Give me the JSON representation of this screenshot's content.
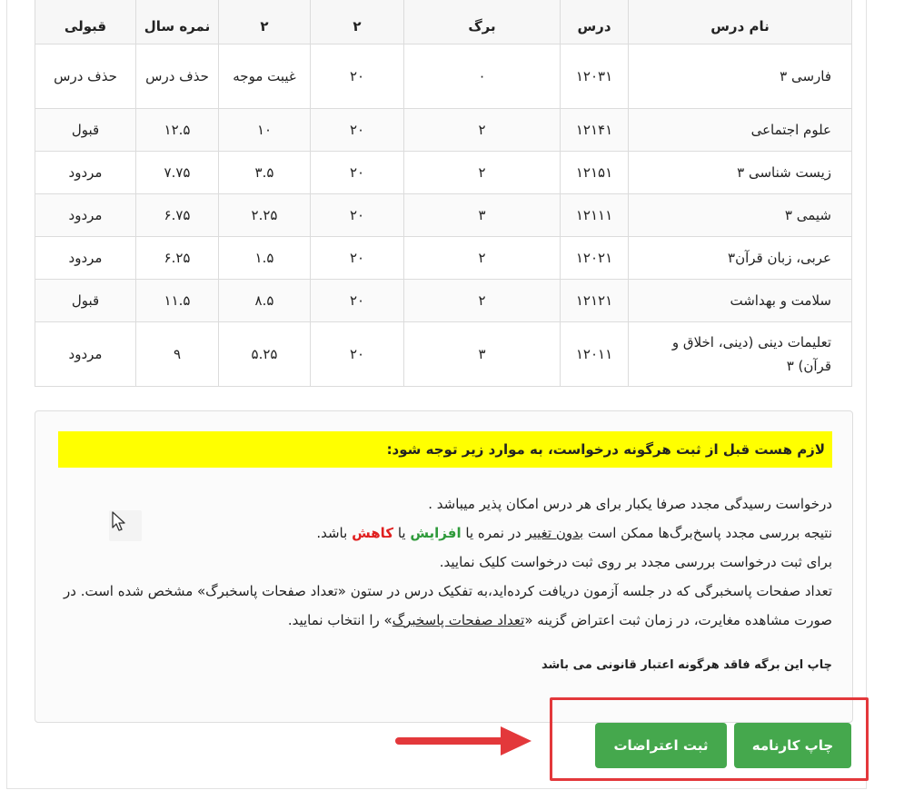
{
  "table": {
    "headers": [
      "نام درس",
      "درس",
      "برگ",
      "۲",
      "۲",
      "نمره سال",
      "قبولی"
    ],
    "rows": [
      [
        "فارسی ۳",
        "۱۲۰۳۱",
        "۰",
        "۲۰",
        "غیبت موجه",
        "حذف درس",
        "حذف درس"
      ],
      [
        "علوم اجتماعی",
        "۱۲۱۴۱",
        "۲",
        "۲۰",
        "۱۰",
        "۱۲.۵",
        "قبول"
      ],
      [
        "زیست شناسی ۳",
        "۱۲۱۵۱",
        "۲",
        "۲۰",
        "۳.۵",
        "۷.۷۵",
        "مردود"
      ],
      [
        "شیمی ۳",
        "۱۲۱۱۱",
        "۳",
        "۲۰",
        "۲.۲۵",
        "۶.۷۵",
        "مردود"
      ],
      [
        "عربی، زبان قرآن۳",
        "۱۲۰۲۱",
        "۲",
        "۲۰",
        "۱.۵",
        "۶.۲۵",
        "مردود"
      ],
      [
        "سلامت و بهداشت",
        "۱۲۱۲۱",
        "۲",
        "۲۰",
        "۸.۵",
        "۱۱.۵",
        "قبول"
      ],
      [
        "تعلیمات دینی (دینی، اخلاق و قرآن) ۳",
        "۱۲۰۱۱",
        "۳",
        "۲۰",
        "۵.۲۵",
        "۹",
        "مردود"
      ]
    ]
  },
  "notice": {
    "warning": "لازم هست قبل از ثبت هرگونه درخواست، به موارد زیر توجه شود:",
    "line1": "درخواست رسیدگی مجدد صرفا یکبار برای هر درس امکان پذیر میباشد .",
    "line2_a": "نتیجه بررسی مجدد پاسخ‌برگ‌ها ممکن است ",
    "line2_u": "بدون تغییر",
    "line2_b": " در نمره یا ",
    "line2_inc": "افزایش",
    "line2_c": " یا ",
    "line2_dec": "کاهش",
    "line2_d": " باشد.",
    "line3": "برای ثبت درخواست بررسی مجدد بر روی ثبت درخواست کلیک نمایید.",
    "line4_a": "تعداد صفحات پاسخبرگی که در جلسه آزمون دریافت کرده‌اید،به تفکیک درس در ستون «تعداد صفحات پاسخبرگ» مشخص شده است. در صورت مشاهده مغایرت، در زمان ثبت اعتراض گزینه «",
    "line4_u": "تعداد صفحات پاسخبرگ",
    "line4_b": "» را انتخاب نمایید.",
    "print_note": "چاپ این برگه فاقد هرگونه اعتبار قانونی می باشد"
  },
  "buttons": {
    "print_label": "چاپ کارنامه",
    "objection_label": "ثبت اعتراضات"
  },
  "colors": {
    "button_green": "#45a84d",
    "highlight_red": "#e3383b",
    "warning_yellow": "#ffff00"
  }
}
